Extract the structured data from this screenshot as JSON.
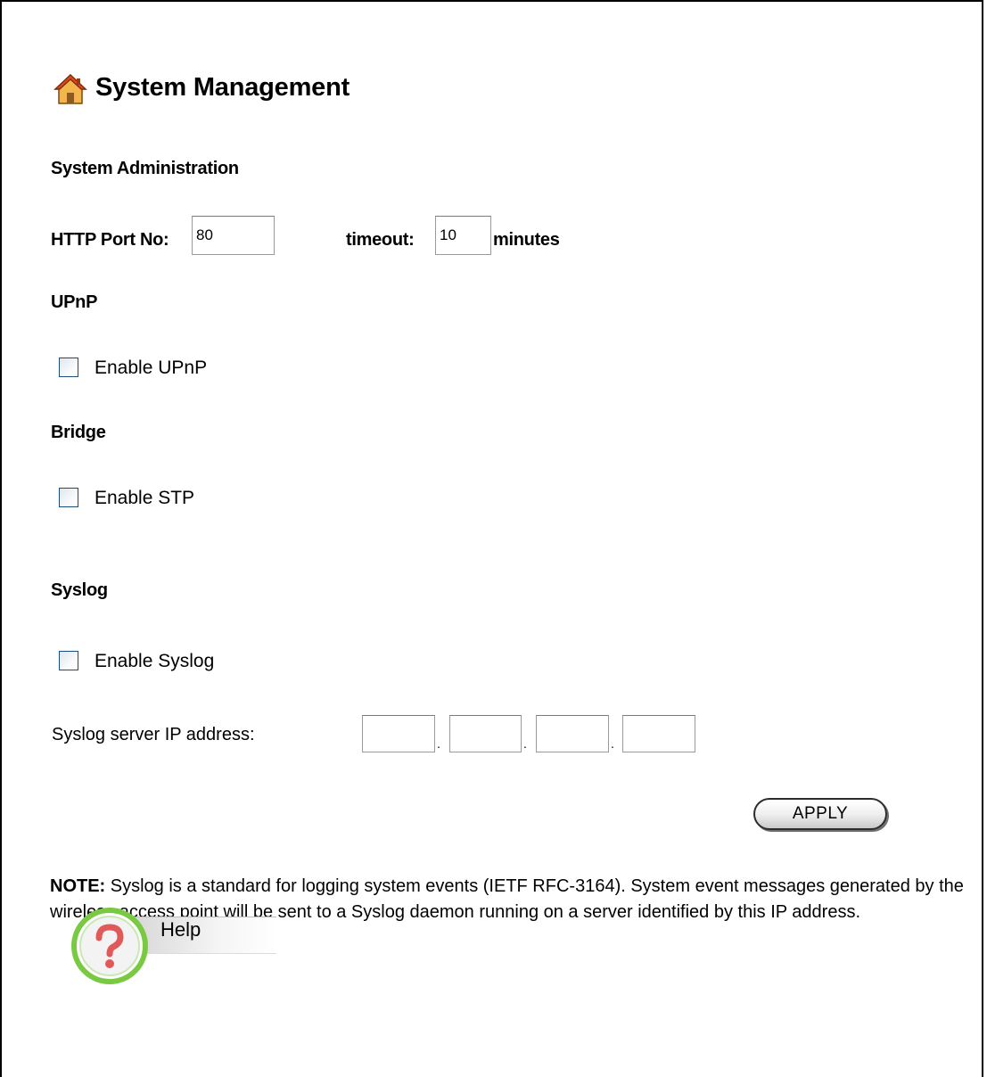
{
  "page": {
    "title": "System Management"
  },
  "system_admin": {
    "heading": "System Administration",
    "http_port_label": "HTTP Port No:",
    "http_port_value": "80",
    "timeout_label": "timeout:",
    "timeout_value": "10",
    "timeout_unit": "minutes"
  },
  "upnp": {
    "heading": "UPnP",
    "enable_label": "Enable UPnP",
    "enabled": false
  },
  "bridge": {
    "heading": "Bridge",
    "enable_label": "Enable STP",
    "enabled": false
  },
  "syslog": {
    "heading": "Syslog",
    "enable_label": "Enable Syslog",
    "enabled": false,
    "server_ip_label": "Syslog server IP address:",
    "ip_octets": [
      "",
      "",
      "",
      ""
    ],
    "separator": "."
  },
  "actions": {
    "apply_label": "APPLY"
  },
  "note": {
    "prefix": "NOTE:",
    "text": " Syslog is a standard for logging system events (IETF RFC-3164). System event messages generated by the wireless access point will be sent to a Syslog daemon running on a server identified by this IP address."
  },
  "help": {
    "label": "Help"
  },
  "colors": {
    "checkbox_border": "#1c4c7a",
    "help_ring": "#7ac943",
    "help_icon": "#e05a5a",
    "home_roof": "#d9461c",
    "home_wall": "#f4b64c"
  }
}
